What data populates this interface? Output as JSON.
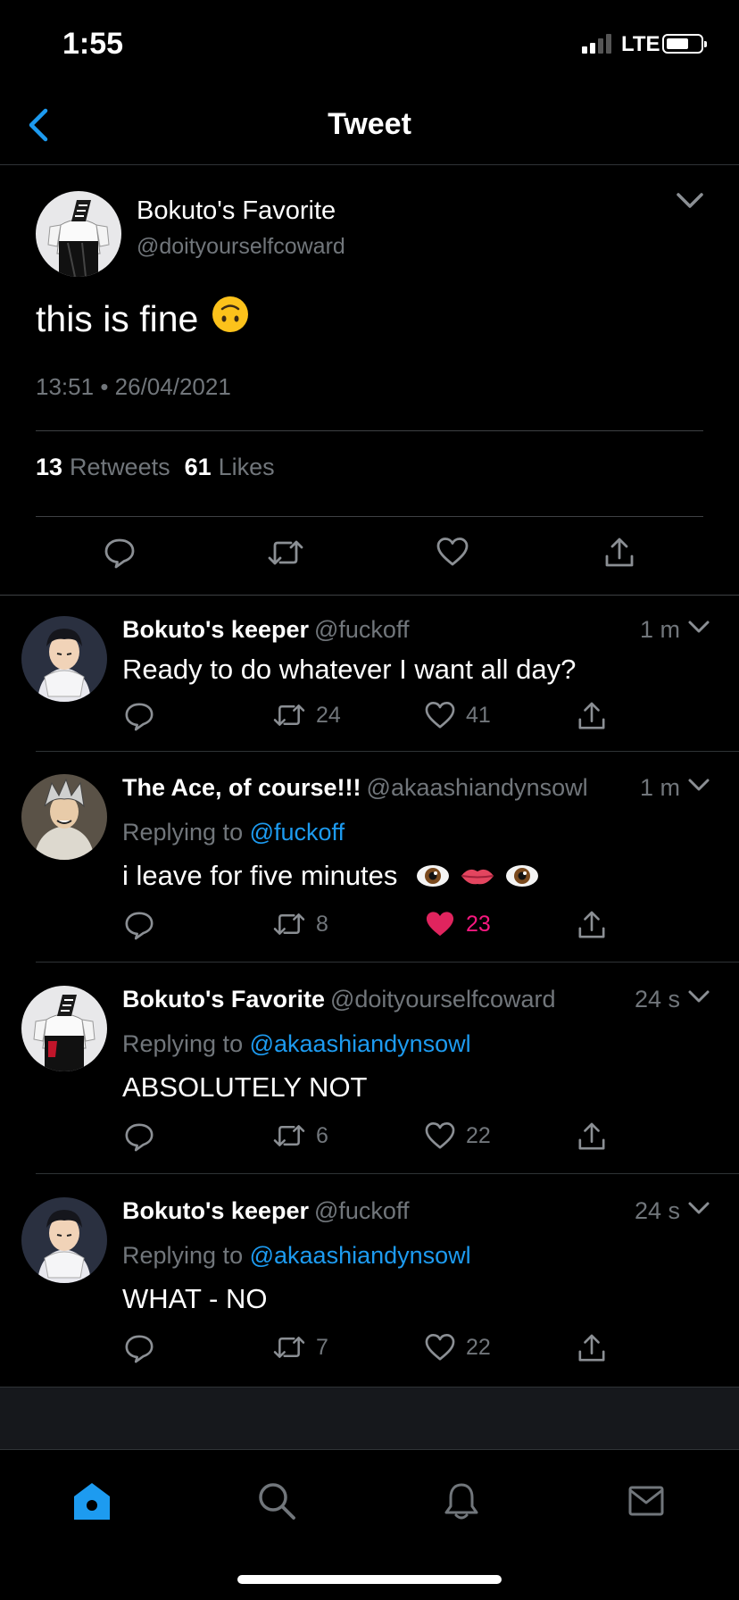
{
  "status_bar": {
    "time": "1:55",
    "network": "LTE"
  },
  "header": {
    "title": "Tweet"
  },
  "main_tweet": {
    "name": "Bokuto's Favorite",
    "handle": "@doityourselfcoward",
    "text": "this is fine",
    "emoji": "🙃",
    "time": "13:51",
    "separator": "•",
    "date": "26/04/2021",
    "retweets_count": "13",
    "retweets_label": "Retweets",
    "likes_count": "61",
    "likes_label": "Likes"
  },
  "replies": [
    {
      "name": "Bokuto's keeper",
      "handle": "@fuckoff",
      "time": "1 m",
      "replying_label": "",
      "replying_to": "",
      "text": "Ready to do whatever I want all day?",
      "emojis": "",
      "retweets": "24",
      "likes": "41",
      "liked": false
    },
    {
      "name": "The Ace, of course!!!",
      "handle": "@akaashiandynsowl",
      "time": "1 m",
      "replying_label": "Replying to",
      "replying_to": "@fuckoff",
      "text": "i leave for five minutes",
      "emojis": "👁️ 👄 👁️",
      "retweets": "8",
      "likes": "23",
      "liked": true
    },
    {
      "name": "Bokuto's Favorite",
      "handle": "@doityourselfcoward",
      "time": "24 s",
      "replying_label": "Replying to",
      "replying_to": "@akaashiandynsowl",
      "text": "ABSOLUTELY NOT",
      "emojis": "",
      "retweets": "6",
      "likes": "22",
      "liked": false
    },
    {
      "name": "Bokuto's keeper",
      "handle": "@fuckoff",
      "time": "24 s",
      "replying_label": "Replying to",
      "replying_to": "@akaashiandynsowl",
      "text": "WHAT - NO",
      "emojis": "",
      "retweets": "7",
      "likes": "22",
      "liked": false
    }
  ],
  "tab_bar": {
    "items": [
      "home-icon",
      "search-icon",
      "bell-icon",
      "mail-icon"
    ],
    "active": "home-icon"
  },
  "colors": {
    "background": "#000000",
    "accent": "#1d9bf0",
    "like_active": "#f91880",
    "muted": "#71767b"
  }
}
